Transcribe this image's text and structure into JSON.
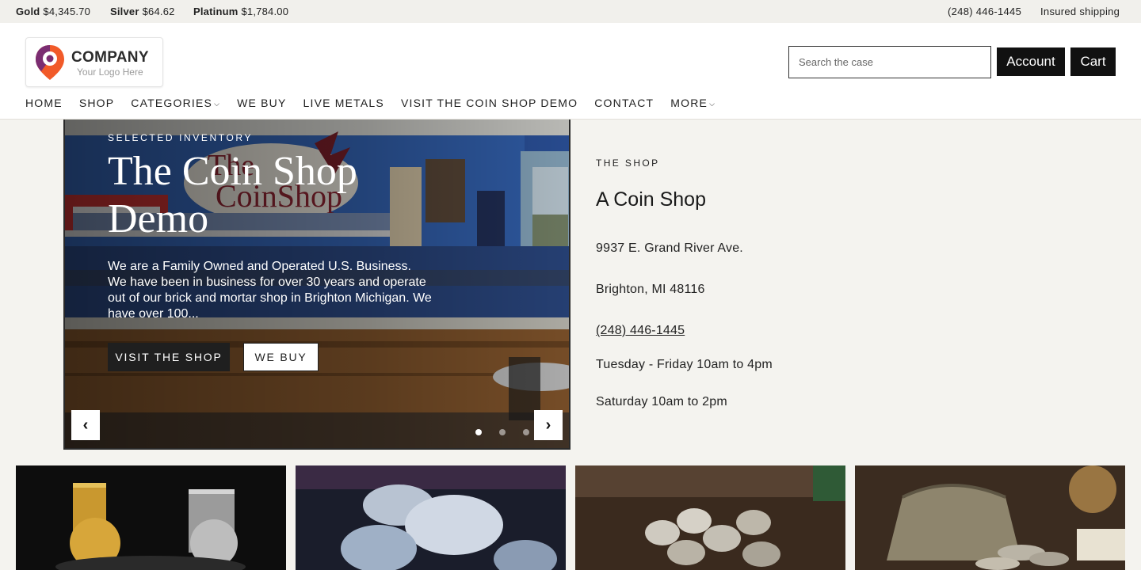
{
  "ticker": {
    "metals": [
      {
        "name": "Gold",
        "price": "$4,345.70"
      },
      {
        "name": "Silver",
        "price": "$64.62"
      },
      {
        "name": "Platinum",
        "price": "$1,784.00"
      }
    ],
    "phone": "(248) 446-1445",
    "shipping": "Insured shipping"
  },
  "header": {
    "logo": {
      "brand": "COMPANY",
      "tagline": "Your Logo Here"
    },
    "search": {
      "placeholder": "Search the case"
    },
    "account_label": "Account",
    "cart_label": "Cart"
  },
  "nav": {
    "items": [
      {
        "label": "HOME"
      },
      {
        "label": "SHOP"
      },
      {
        "label": "CATEGORIES"
      },
      {
        "label": "WE BUY"
      },
      {
        "label": "LIVE METALS"
      },
      {
        "label": "VISIT THE COIN SHOP DEMO"
      },
      {
        "label": "CONTACT"
      },
      {
        "label": "MORE"
      }
    ]
  },
  "hero": {
    "eyebrow": "SELECTED INVENTORY",
    "title": "The Coin Shop Demo",
    "description": "We are a Family Owned and Operated U.S. Business. We have been in business for over 30 years and operate out of our brick and mortar shop in Brighton Michigan. We have over 100...",
    "primary_label": "VISIT THE SHOP",
    "secondary_label": "WE BUY",
    "prev": "‹",
    "next": "›",
    "slide_count": 3,
    "active_slide": 1
  },
  "shop": {
    "eyebrow": "THE SHOP",
    "title": "A Coin Shop",
    "address1": "9937 E. Grand River Ave.",
    "address2": "Brighton, MI 48116",
    "phone": "(248) 446-1445",
    "hours1": "Tuesday - Friday 10am to 4pm",
    "hours2": "Saturday 10am to 2pm"
  },
  "colors": {
    "page_bg": "#f4f3ef",
    "dark": "#111111",
    "logo_orange": "#f15a29",
    "logo_purple": "#7b2d72"
  }
}
